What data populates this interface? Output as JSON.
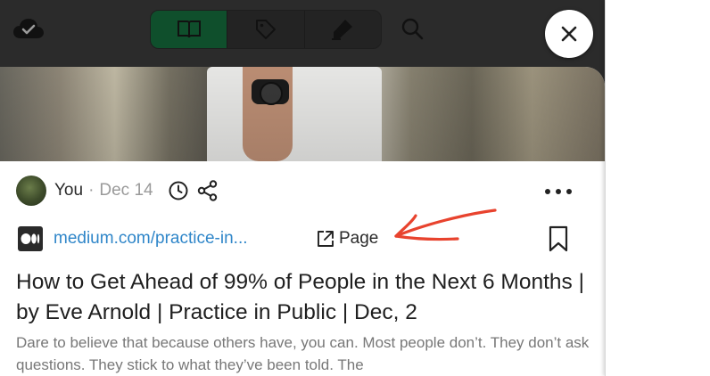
{
  "toolbar": {
    "icons": {
      "cloud": "cloud-check-icon",
      "read": "book-open-icon",
      "tags": "tag-icon",
      "highlight": "highlighter-icon",
      "search": "search-icon",
      "close": "close-icon"
    },
    "active_tab": "read"
  },
  "article": {
    "author": "You",
    "separator": "·",
    "date": "Dec 14",
    "source_url": "medium.com/practice-in...",
    "page_label": "Page",
    "title": "How to Get Ahead of 99% of People in the Next 6 Months | by Eve Arnold | Practice in Public | Dec, 2",
    "description": "Dare to believe that because others have, you can. Most people don’t. They don’t ask questions. They stick to what they’ve been told. The"
  },
  "colors": {
    "accent_green": "#0f4f2c",
    "link_blue": "#2f86c9",
    "annotation_red": "#e8432e"
  }
}
